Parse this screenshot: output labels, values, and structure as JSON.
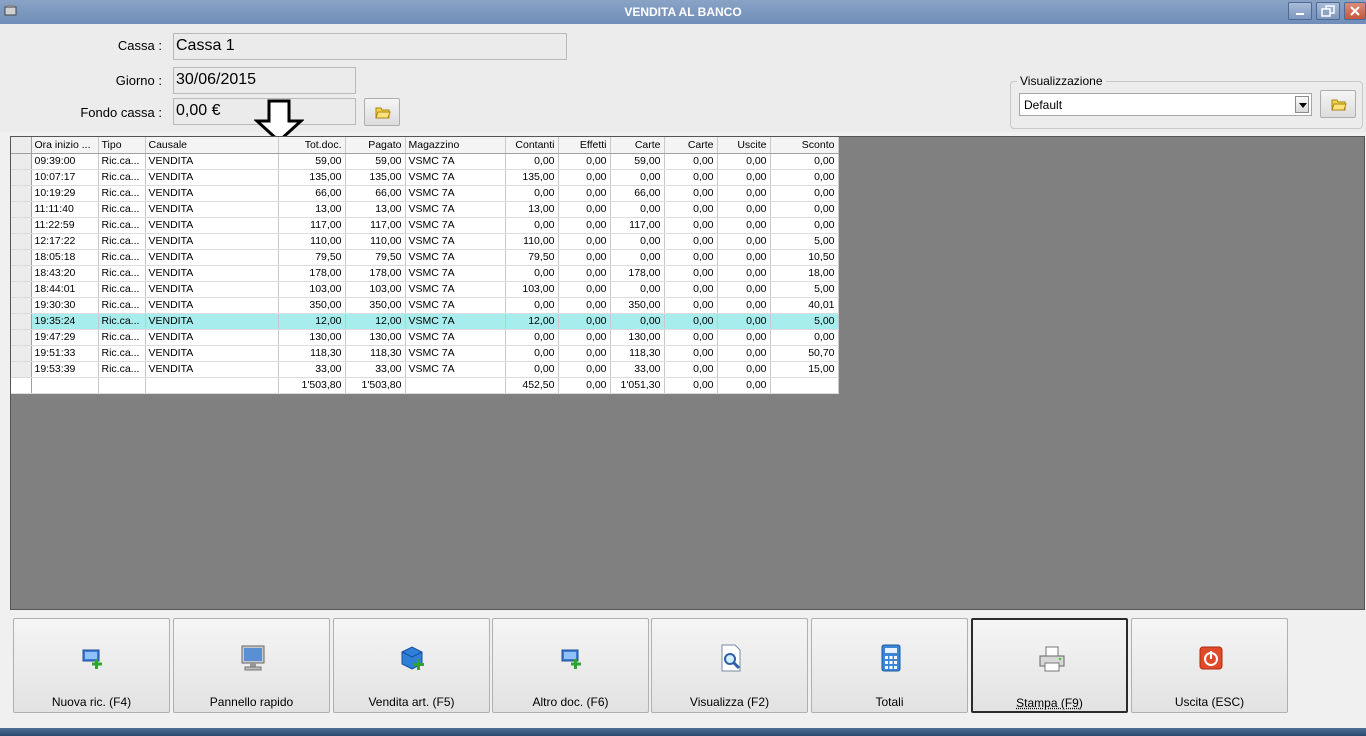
{
  "window": {
    "title": "VENDITA AL BANCO"
  },
  "form": {
    "cassa_label": "Cassa :",
    "cassa_value": "Cassa 1",
    "giorno_label": "Giorno :",
    "giorno_value": "30/06/2015",
    "fondo_label": "Fondo cassa :",
    "fondo_value": "0,00 €"
  },
  "visualizzazione": {
    "legend": "Visualizzazione",
    "selected": "Default"
  },
  "grid": {
    "headers": [
      "Ora inizio ...",
      "Tipo",
      "Causale",
      "Tot.doc.",
      "Pagato",
      "Magazzino",
      "Contanti",
      "Effetti",
      "Carte",
      "Carte",
      "Uscite",
      "Sconto"
    ],
    "rows": [
      [
        "09:39:00",
        "Ric.ca...",
        "VENDITA",
        "59,00",
        "59,00",
        "VSMC 7A",
        "0,00",
        "0,00",
        "59,00",
        "0,00",
        "0,00",
        "0,00"
      ],
      [
        "10:07:17",
        "Ric.ca...",
        "VENDITA",
        "135,00",
        "135,00",
        "VSMC 7A",
        "135,00",
        "0,00",
        "0,00",
        "0,00",
        "0,00",
        "0,00"
      ],
      [
        "10:19:29",
        "Ric.ca...",
        "VENDITA",
        "66,00",
        "66,00",
        "VSMC 7A",
        "0,00",
        "0,00",
        "66,00",
        "0,00",
        "0,00",
        "0,00"
      ],
      [
        "11:11:40",
        "Ric.ca...",
        "VENDITA",
        "13,00",
        "13,00",
        "VSMC 7A",
        "13,00",
        "0,00",
        "0,00",
        "0,00",
        "0,00",
        "0,00"
      ],
      [
        "11:22:59",
        "Ric.ca...",
        "VENDITA",
        "117,00",
        "117,00",
        "VSMC 7A",
        "0,00",
        "0,00",
        "117,00",
        "0,00",
        "0,00",
        "0,00"
      ],
      [
        "12:17:22",
        "Ric.ca...",
        "VENDITA",
        "110,00",
        "110,00",
        "VSMC 7A",
        "110,00",
        "0,00",
        "0,00",
        "0,00",
        "0,00",
        "5,00"
      ],
      [
        "18:05:18",
        "Ric.ca...",
        "VENDITA",
        "79,50",
        "79,50",
        "VSMC 7A",
        "79,50",
        "0,00",
        "0,00",
        "0,00",
        "0,00",
        "10,50"
      ],
      [
        "18:43:20",
        "Ric.ca...",
        "VENDITA",
        "178,00",
        "178,00",
        "VSMC 7A",
        "0,00",
        "0,00",
        "178,00",
        "0,00",
        "0,00",
        "18,00"
      ],
      [
        "18:44:01",
        "Ric.ca...",
        "VENDITA",
        "103,00",
        "103,00",
        "VSMC 7A",
        "103,00",
        "0,00",
        "0,00",
        "0,00",
        "0,00",
        "5,00"
      ],
      [
        "19:30:30",
        "Ric.ca...",
        "VENDITA",
        "350,00",
        "350,00",
        "VSMC 7A",
        "0,00",
        "0,00",
        "350,00",
        "0,00",
        "0,00",
        "40,01"
      ],
      [
        "19:35:24",
        "Ric.ca...",
        "VENDITA",
        "12,00",
        "12,00",
        "VSMC 7A",
        "12,00",
        "0,00",
        "0,00",
        "0,00",
        "0,00",
        "5,00"
      ],
      [
        "19:47:29",
        "Ric.ca...",
        "VENDITA",
        "130,00",
        "130,00",
        "VSMC 7A",
        "0,00",
        "0,00",
        "130,00",
        "0,00",
        "0,00",
        "0,00"
      ],
      [
        "19:51:33",
        "Ric.ca...",
        "VENDITA",
        "118,30",
        "118,30",
        "VSMC 7A",
        "0,00",
        "0,00",
        "118,30",
        "0,00",
        "0,00",
        "50,70"
      ],
      [
        "19:53:39",
        "Ric.ca...",
        "VENDITA",
        "33,00",
        "33,00",
        "VSMC 7A",
        "0,00",
        "0,00",
        "33,00",
        "0,00",
        "0,00",
        "15,00"
      ]
    ],
    "highlighted_row": 10,
    "totals": [
      "",
      "",
      "",
      "1'503,80",
      "1'503,80",
      "",
      "452,50",
      "0,00",
      "1'051,30",
      "0,00",
      "0,00",
      ""
    ]
  },
  "buttons": [
    {
      "label": "Nuova ric. (F4)",
      "icon": "monitor-add-icon",
      "name": "nuova-ric-button"
    },
    {
      "label": "Pannello rapido",
      "icon": "computer-icon",
      "name": "pannello-rapido-button"
    },
    {
      "label": "Vendita art. (F5)",
      "icon": "box-add-icon",
      "name": "vendita-art-button"
    },
    {
      "label": "Altro doc. (F6)",
      "icon": "monitor-add-icon",
      "name": "altro-doc-button"
    },
    {
      "label": "Visualizza (F2)",
      "icon": "document-search-icon",
      "name": "visualizza-button"
    },
    {
      "label": "Totali",
      "icon": "calculator-icon",
      "name": "totali-button"
    },
    {
      "label": "Stampa (F9)",
      "icon": "printer-icon",
      "name": "stampa-button"
    },
    {
      "label": "Uscita (ESC)",
      "icon": "power-icon",
      "name": "uscita-button"
    }
  ],
  "colors": {
    "highlight_row": "#a8eded",
    "grid_background": "#808080",
    "titlebar": "#7b97c0"
  }
}
